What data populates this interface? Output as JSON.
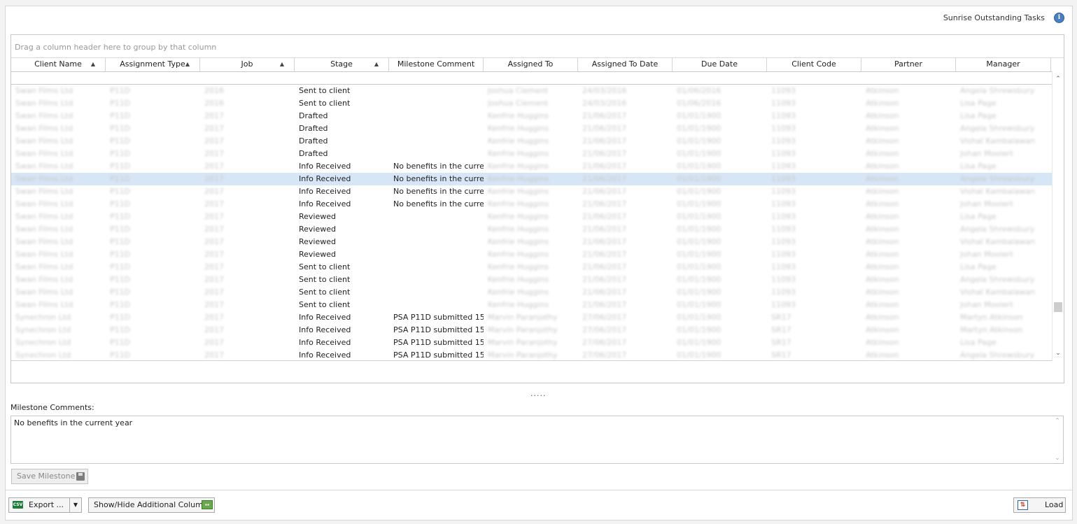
{
  "window": {
    "title": "Sunrise Outstanding Tasks"
  },
  "icons": {
    "info": "info-icon",
    "export": "csv-export-icon",
    "columns": "show-hide-columns-icon",
    "save": "floppy-disk-icon",
    "load": "load-icon"
  },
  "grid": {
    "group_panel": "Drag a column header here to group by that column",
    "columns": [
      {
        "label": "Client Name",
        "sorted": true
      },
      {
        "label": "Assignment Type",
        "sorted": true
      },
      {
        "label": "Job",
        "sorted": true
      },
      {
        "label": "Stage",
        "sorted": true
      },
      {
        "label": "Milestone Comment",
        "sorted": false
      },
      {
        "label": "Assigned To",
        "sorted": false
      },
      {
        "label": "Assigned To Date",
        "sorted": false
      },
      {
        "label": "Due Date",
        "sorted": false
      },
      {
        "label": "Client Code",
        "sorted": false
      },
      {
        "label": "Partner",
        "sorted": false
      },
      {
        "label": "Manager",
        "sorted": false
      }
    ],
    "selected_row": 7,
    "rows": [
      [
        "Swan Films Ltd",
        "P11D",
        "2016",
        "Sent to client",
        "",
        "Joshua Clement",
        "24/03/2016",
        "01/06/2016",
        "11093",
        "Atkinson",
        "Angela Shrewsbury"
      ],
      [
        "Swan Films Ltd",
        "P11D",
        "2016",
        "Sent to client",
        "",
        "Joshua Clement",
        "24/03/2016",
        "01/06/2016",
        "11093",
        "Atkinson",
        "Lisa Page"
      ],
      [
        "Swan Films Ltd",
        "P11D",
        "2017",
        "Drafted",
        "",
        "Kenfrie Huggins",
        "21/06/2017",
        "01/01/1900",
        "11093",
        "Atkinson",
        "Lisa Page"
      ],
      [
        "Swan Films Ltd",
        "P11D",
        "2017",
        "Drafted",
        "",
        "Kenfrie Huggins",
        "21/06/2017",
        "01/01/1900",
        "11093",
        "Atkinson",
        "Angela Shrewsbury"
      ],
      [
        "Swan Films Ltd",
        "P11D",
        "2017",
        "Drafted",
        "",
        "Kenfrie Huggins",
        "21/06/2017",
        "01/01/1900",
        "11093",
        "Atkinson",
        "Vishal Kambalawan"
      ],
      [
        "Swan Films Ltd",
        "P11D",
        "2017",
        "Drafted",
        "",
        "Kenfrie Huggins",
        "21/06/2017",
        "01/01/1900",
        "11093",
        "Atkinson",
        "Johan Moolert"
      ],
      [
        "Swan Films Ltd",
        "P11D",
        "2017",
        "Info Received",
        "No benefits in the curre…",
        "Kenfrie Huggins",
        "21/06/2017",
        "01/01/1900",
        "11093",
        "Atkinson",
        "Lisa Page"
      ],
      [
        "Swan Films Ltd",
        "P11D",
        "2017",
        "Info Received",
        "No benefits in the curre…",
        "Kenfrie Huggins",
        "21/06/2017",
        "01/01/1900",
        "11093",
        "Atkinson",
        "Angela Shrewsbury"
      ],
      [
        "Swan Films Ltd",
        "P11D",
        "2017",
        "Info Received",
        "No benefits in the curre…",
        "Kenfrie Huggins",
        "21/06/2017",
        "01/01/1900",
        "11093",
        "Atkinson",
        "Vishal Kambalawan"
      ],
      [
        "Swan Films Ltd",
        "P11D",
        "2017",
        "Info Received",
        "No benefits in the curre…",
        "Kenfrie Huggins",
        "21/06/2017",
        "01/01/1900",
        "11093",
        "Atkinson",
        "Johan Moolert"
      ],
      [
        "Swan Films Ltd",
        "P11D",
        "2017",
        "Reviewed",
        "",
        "Kenfrie Huggins",
        "21/06/2017",
        "01/01/1900",
        "11093",
        "Atkinson",
        "Lisa Page"
      ],
      [
        "Swan Films Ltd",
        "P11D",
        "2017",
        "Reviewed",
        "",
        "Kenfrie Huggins",
        "21/06/2017",
        "01/01/1900",
        "11093",
        "Atkinson",
        "Angela Shrewsbury"
      ],
      [
        "Swan Films Ltd",
        "P11D",
        "2017",
        "Reviewed",
        "",
        "Kenfrie Huggins",
        "21/06/2017",
        "01/01/1900",
        "11093",
        "Atkinson",
        "Vishal Kambalawan"
      ],
      [
        "Swan Films Ltd",
        "P11D",
        "2017",
        "Reviewed",
        "",
        "Kenfrie Huggins",
        "21/06/2017",
        "01/01/1900",
        "11093",
        "Atkinson",
        "Johan Moolert"
      ],
      [
        "Swan Films Ltd",
        "P11D",
        "2017",
        "Sent to client",
        "",
        "Kenfrie Huggins",
        "21/06/2017",
        "01/01/1900",
        "11093",
        "Atkinson",
        "Lisa Page"
      ],
      [
        "Swan Films Ltd",
        "P11D",
        "2017",
        "Sent to client",
        "",
        "Kenfrie Huggins",
        "21/06/2017",
        "01/01/1900",
        "11093",
        "Atkinson",
        "Angela Shrewsbury"
      ],
      [
        "Swan Films Ltd",
        "P11D",
        "2017",
        "Sent to client",
        "",
        "Kenfrie Huggins",
        "21/06/2017",
        "01/01/1900",
        "11093",
        "Atkinson",
        "Vishal Kambalawan"
      ],
      [
        "Swan Films Ltd",
        "P11D",
        "2017",
        "Sent to client",
        "",
        "Kenfrie Huggins",
        "21/06/2017",
        "01/01/1900",
        "11093",
        "Atkinson",
        "Johan Moolert"
      ],
      [
        "Synechron Ltd",
        "P11D",
        "2017",
        "Info Received",
        "PSA P11D submitted 15/…",
        "Marvin Paranjothy",
        "27/06/2017",
        "01/01/1900",
        "SR17",
        "Atkinson",
        "Martyn Atkinson"
      ],
      [
        "Synechron Ltd",
        "P11D",
        "2017",
        "Info Received",
        "PSA P11D submitted 15/…",
        "Marvin Paranjothy",
        "27/06/2017",
        "01/01/1900",
        "SR17",
        "Atkinson",
        "Martyn Atkinson"
      ],
      [
        "Synechron Ltd",
        "P11D",
        "2017",
        "Info Received",
        "PSA P11D submitted 15/…",
        "Marvin Paranjothy",
        "27/06/2017",
        "01/01/1900",
        "SR17",
        "Atkinson",
        "Lisa Page"
      ],
      [
        "Synechron Ltd",
        "P11D",
        "2017",
        "Info Received",
        "PSA P11D submitted 15/…",
        "Marvin Paranjothy",
        "27/06/2017",
        "01/01/1900",
        "SR17",
        "Atkinson",
        "Angela Shrewsbury"
      ]
    ]
  },
  "splitter": ".....",
  "milestone": {
    "label": "Milestone Comments:",
    "text": "No benefits in the current year",
    "save_label": "Save Milestone"
  },
  "footer": {
    "export_label": "Export ...",
    "columns_label": "Show/Hide Additional Columns",
    "load_label": "Load"
  }
}
